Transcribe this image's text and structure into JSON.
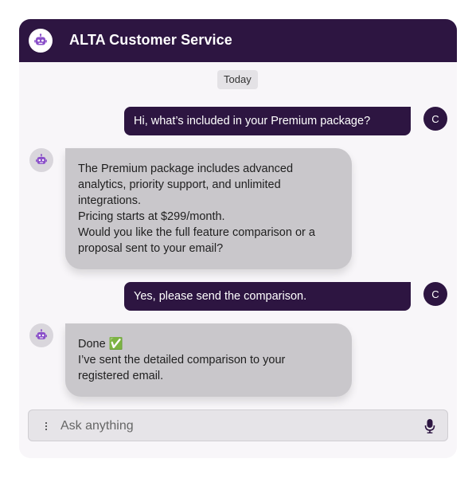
{
  "header": {
    "title": "ALTA Customer Service",
    "avatar_icon": "robot-icon"
  },
  "date_chip": "Today",
  "messages": [
    {
      "sender": "user",
      "avatar_initial": "C",
      "lines": [
        "Hi, what’s included in your Premium package?"
      ]
    },
    {
      "sender": "bot",
      "avatar_icon": "robot-icon",
      "lines": [
        "The Premium package includes advanced",
        "analytics, priority support, and unlimited",
        "integrations.",
        "Pricing starts at $299/month.",
        "Would you like the full feature comparison or a",
        "proposal sent to your email?"
      ]
    },
    {
      "sender": "user",
      "avatar_initial": "C",
      "lines": [
        "Yes, please send the comparison."
      ]
    },
    {
      "sender": "bot",
      "avatar_icon": "robot-icon",
      "lines": [
        "Done ✅",
        "I’ve sent the detailed comparison to your",
        "registered email."
      ]
    }
  ],
  "composer": {
    "placeholder": "Ask anything",
    "value": "",
    "menu_icon": "more-vertical-icon",
    "mic_icon": "microphone-icon"
  },
  "colors": {
    "brand": "#2d1541",
    "bot_bubble": "#c9c7cb",
    "background": "#f8f6f9",
    "robot_accent": "#8a4fc9"
  }
}
